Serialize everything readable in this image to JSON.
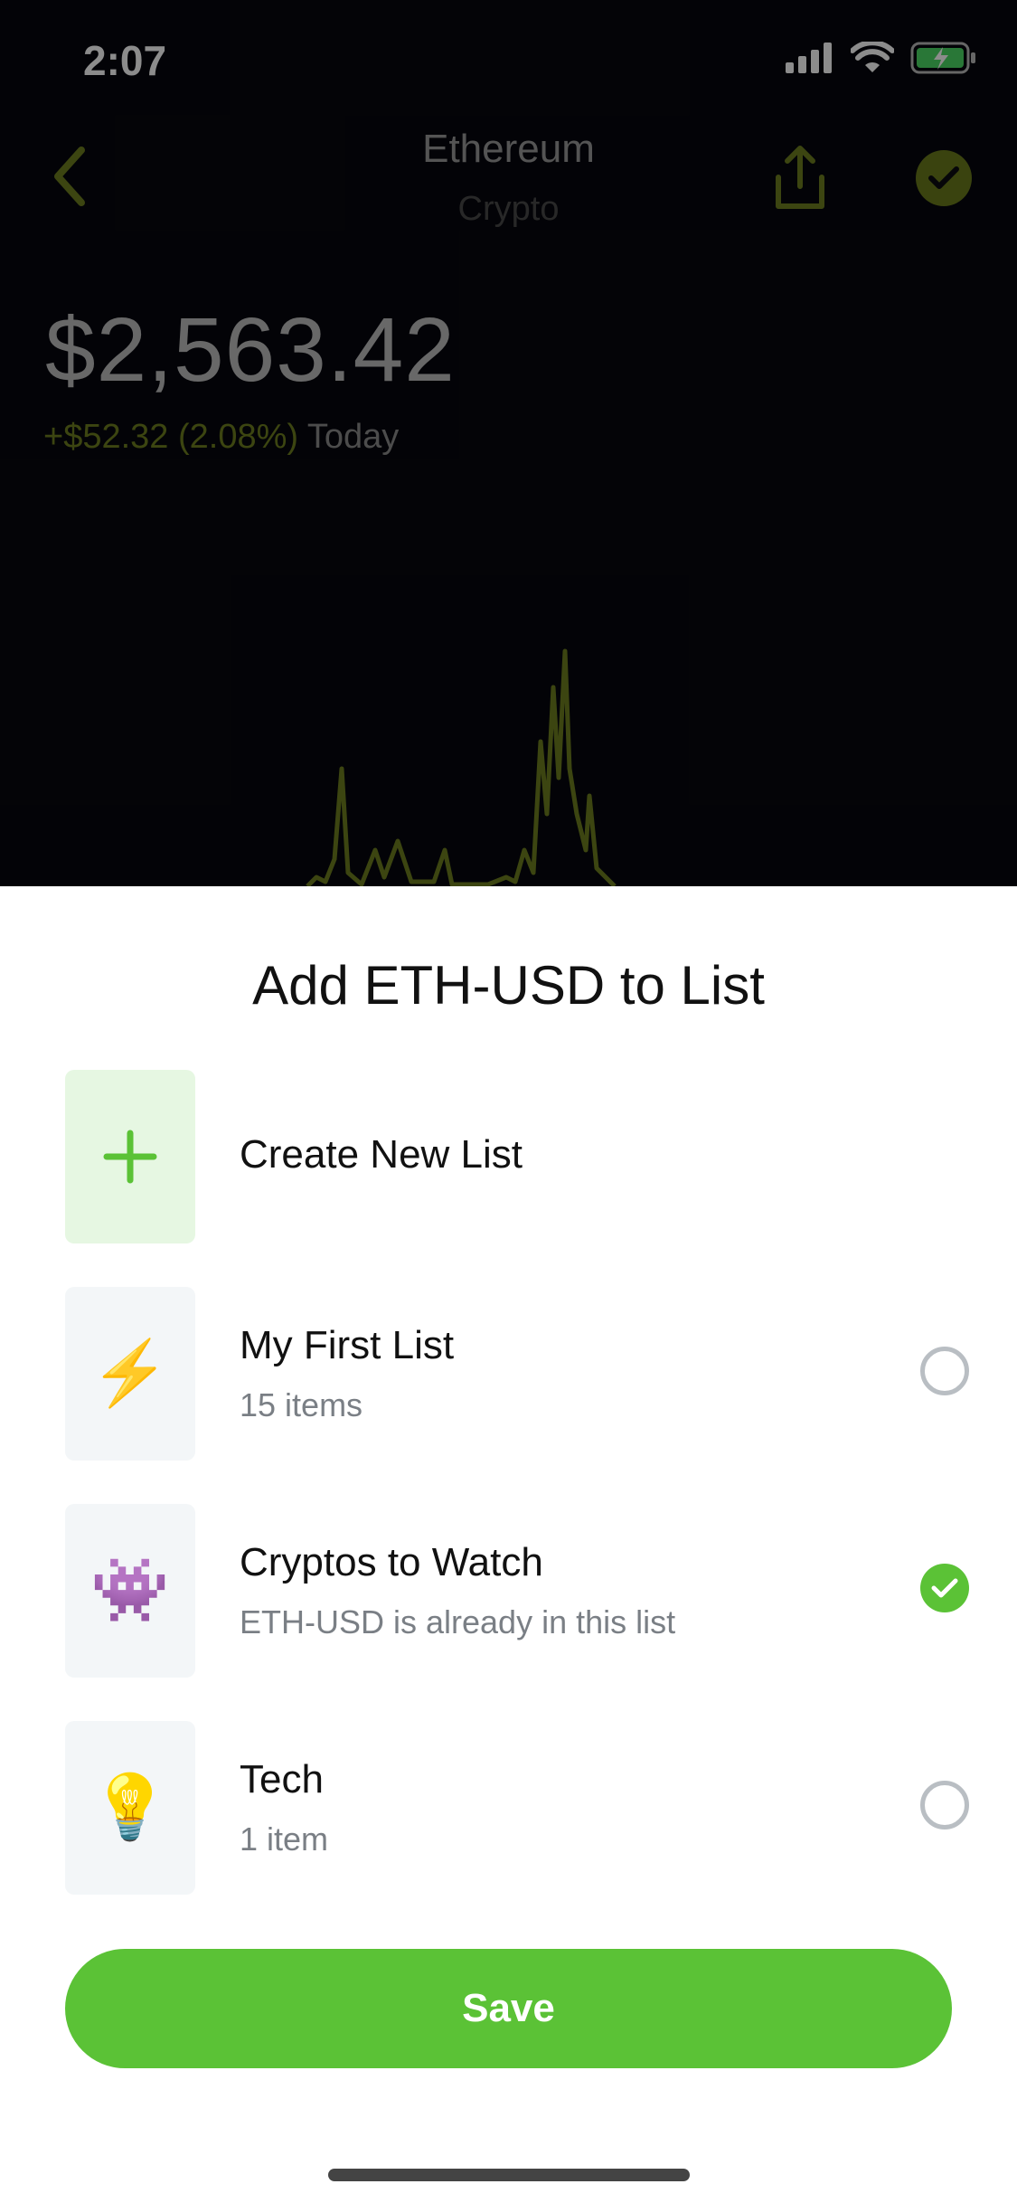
{
  "status": {
    "time": "2:07"
  },
  "header": {
    "title": "Ethereum",
    "subtitle": "Crypto"
  },
  "quote": {
    "price": "$2,563.42",
    "change": "+$52.32 (2.08%)",
    "period": "Today"
  },
  "sheet": {
    "title": "Add ETH-USD to List",
    "create_label": "Create New List",
    "lists": [
      {
        "title": "My First List",
        "subtitle": "15 items",
        "icon": "⚡",
        "checked": false
      },
      {
        "title": "Cryptos to Watch",
        "subtitle": "ETH-USD is already in this list",
        "icon": "👾",
        "checked": true
      },
      {
        "title": "Tech",
        "subtitle": "1 item",
        "icon": "💡",
        "checked": false
      }
    ],
    "save_label": "Save"
  },
  "colors": {
    "accent": "#5bc236",
    "dim_accent": "#6e7f1f"
  }
}
